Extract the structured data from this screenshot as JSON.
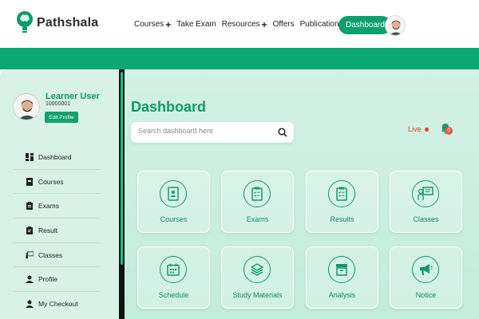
{
  "header": {
    "brand": "Pathshala",
    "nav": [
      {
        "label": "Courses",
        "plus": "+"
      },
      {
        "label": "Take Exam",
        "plus": ""
      },
      {
        "label": "Resources",
        "plus": "+"
      },
      {
        "label": "Offers",
        "plus": ""
      },
      {
        "label": "Publications",
        "plus": ""
      }
    ],
    "dashboard_button": "Dashboard"
  },
  "sidebar": {
    "user_name": "Learner User",
    "user_id": "10000001",
    "edit_profile": "Edit Profile",
    "items": [
      {
        "label": "Dashboard",
        "icon": "grid-icon"
      },
      {
        "label": "Courses",
        "icon": "book-icon"
      },
      {
        "label": "Exams",
        "icon": "clipboard-icon"
      },
      {
        "label": "Result",
        "icon": "clipboard-list-icon"
      },
      {
        "label": "Classes",
        "icon": "presentation-icon"
      },
      {
        "label": "Profile",
        "icon": "user-icon"
      },
      {
        "label": "My Checkout",
        "icon": "user-icon"
      }
    ]
  },
  "main": {
    "title": "Dashboard",
    "search_placeholder": "Search dashboard here",
    "live_label": "Live",
    "notification_count": "0",
    "cards": [
      {
        "label": "Courses",
        "icon": "book-icon"
      },
      {
        "label": "Exams",
        "icon": "clipboard-check-icon"
      },
      {
        "label": "Results",
        "icon": "clipboard-list-icon"
      },
      {
        "label": "Classes",
        "icon": "presentation-icon"
      },
      {
        "label": "Schedule",
        "icon": "calendar-icon"
      },
      {
        "label": "Study Materials",
        "icon": "layers-icon"
      },
      {
        "label": "Analysis",
        "icon": "archive-icon"
      },
      {
        "label": "Notice",
        "icon": "megaphone-icon"
      }
    ]
  },
  "colors": {
    "accent": "#0e9a6a",
    "band": "#0aa773",
    "live": "#e53935"
  }
}
